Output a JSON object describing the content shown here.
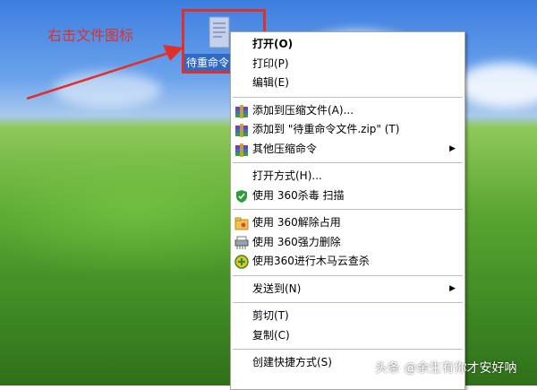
{
  "annotation": {
    "text": "右击文件图标"
  },
  "desktop_icon": {
    "label": "待重命令"
  },
  "context_menu": {
    "items": [
      {
        "label": "打开(O)",
        "bold": true,
        "icon": null,
        "submenu": false
      },
      {
        "label": "打印(P)",
        "icon": null,
        "submenu": false
      },
      {
        "label": "编辑(E)",
        "icon": null,
        "submenu": false
      },
      {
        "separator": true
      },
      {
        "label": "添加到压缩文件(A)...",
        "icon": "winrar-icon",
        "submenu": false
      },
      {
        "label": "添加到 \"待重命令文件.zip\" (T)",
        "icon": "winrar-icon",
        "submenu": false
      },
      {
        "label": "其他压缩命令",
        "icon": "winrar-icon",
        "submenu": true
      },
      {
        "separator": true
      },
      {
        "label": "打开方式(H)...",
        "icon": null,
        "submenu": false
      },
      {
        "label": "使用 360杀毒 扫描",
        "icon": "shield-icon",
        "submenu": false
      },
      {
        "separator": true
      },
      {
        "label": "使用 360解除占用",
        "icon": "unlock-folder-icon",
        "submenu": false
      },
      {
        "label": "使用 360强力删除",
        "icon": "shredder-icon",
        "submenu": false
      },
      {
        "label": "使用360进行木马云查杀",
        "icon": "plus-circle-icon",
        "submenu": false
      },
      {
        "separator": true
      },
      {
        "label": "发送到(N)",
        "icon": null,
        "submenu": true
      },
      {
        "separator": true
      },
      {
        "label": "剪切(T)",
        "icon": null,
        "submenu": false
      },
      {
        "label": "复制(C)",
        "icon": null,
        "submenu": false
      },
      {
        "separator": true
      },
      {
        "label": "创建快捷方式(S)",
        "icon": null,
        "submenu": false
      }
    ]
  },
  "watermark": {
    "text": "头条 @余生有你才安好呐"
  },
  "colors": {
    "annotation_red": "#e0302a",
    "selection_blue": "#316ac5"
  }
}
